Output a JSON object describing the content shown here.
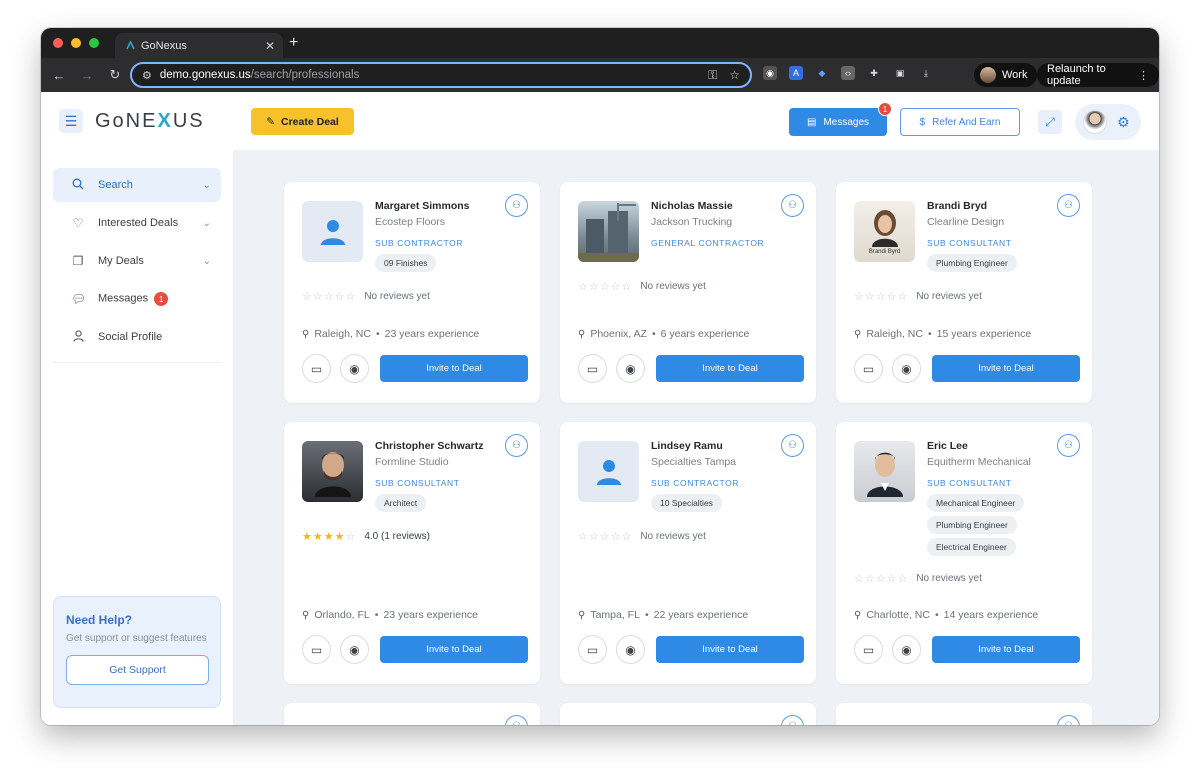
{
  "browser": {
    "tab_title": "GoNexus",
    "url_host": "demo.gonexus.us",
    "url_path": "/search/professionals",
    "profile_label": "Work",
    "relaunch_label": "Relaunch to update"
  },
  "app": {
    "logo_text_left": "GoNE",
    "logo_text_x": "X",
    "logo_text_right": "US",
    "create_deal_label": "Create Deal",
    "messages_label": "Messages",
    "messages_badge": "1",
    "refer_label": "Refer And Earn"
  },
  "sidebar": {
    "items": [
      {
        "label": "Search",
        "icon": "search-icon"
      },
      {
        "label": "Interested Deals",
        "icon": "heart-icon"
      },
      {
        "label": "My Deals",
        "icon": "copy-icon"
      },
      {
        "label": "Messages",
        "icon": "chat-icon",
        "badge": "1"
      },
      {
        "label": "Social Profile",
        "icon": "person-icon"
      }
    ],
    "help": {
      "title": "Need Help?",
      "text": "Get support or suggest features",
      "button": "Get Support"
    }
  },
  "cards": [
    {
      "name": "Margaret Simmons",
      "company": "Ecostep Floors",
      "role": "SUB CONTRACTOR",
      "tags": [
        "09 Finishes"
      ],
      "stars": 0,
      "rating_text": "No reviews yet",
      "location": "Raleigh, NC",
      "experience": "23 years experience",
      "invite": "Invite to Deal"
    },
    {
      "name": "Nicholas Massie",
      "company": "Jackson Trucking",
      "role": "GENERAL CONTRACTOR",
      "tags": [],
      "stars": 0,
      "rating_text": "No reviews yet",
      "location": "Phoenix, AZ",
      "experience": "6 years experience",
      "invite": "Invite to Deal"
    },
    {
      "name": "Brandi Bryd",
      "company": "Clearline Design",
      "role": "SUB CONSULTANT",
      "tags": [
        "Plumbing Engineer"
      ],
      "stars": 0,
      "rating_text": "No reviews yet",
      "location": "Raleigh, NC",
      "experience": "15 years experience",
      "invite": "Invite to Deal",
      "photo_caption": "Brandi Byrd"
    },
    {
      "name": "Christopher Schwartz",
      "company": "Formline Studio",
      "role": "SUB CONSULTANT",
      "tags": [
        "Architect"
      ],
      "stars": 4,
      "rating_text": "4.0 (1 reviews)",
      "location": "Orlando, FL",
      "experience": "23 years experience",
      "invite": "Invite to Deal"
    },
    {
      "name": "Lindsey Ramu",
      "company": "Specialties Tampa",
      "role": "SUB CONTRACTOR",
      "tags": [
        "10 Specialties"
      ],
      "stars": 0,
      "rating_text": "No reviews yet",
      "location": "Tampa, FL",
      "experience": "22 years experience",
      "invite": "Invite to Deal"
    },
    {
      "name": "Eric Lee",
      "company": "Equitherm Mechanical",
      "role": "SUB CONSULTANT",
      "tags": [
        "Mechanical Engineer",
        "Plumbing Engineer",
        "Electrical Engineer"
      ],
      "stars": 0,
      "rating_text": "No reviews yet",
      "location": "Charlotte, NC",
      "experience": "14 years experience",
      "invite": "Invite to Deal"
    }
  ],
  "colors": {
    "accent": "#2f8ae6",
    "yellow": "#f6c12a",
    "badge": "#e74c3c"
  }
}
